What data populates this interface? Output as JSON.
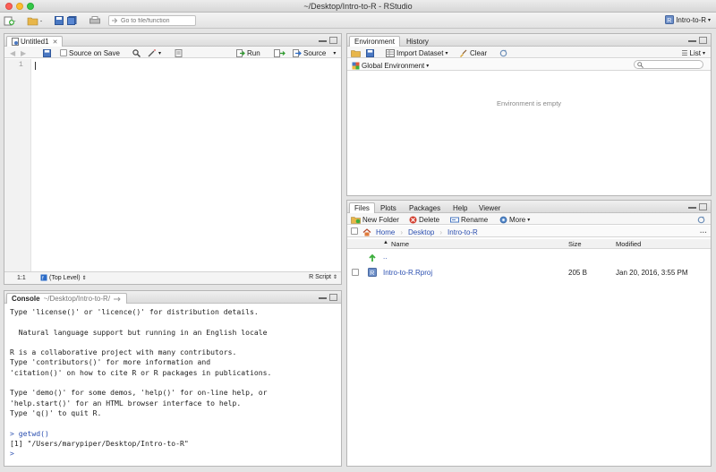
{
  "window": {
    "title": "~/Desktop/Intro-to-R - RStudio"
  },
  "toolbar": {
    "go_to_file_placeholder": "Go to file/function",
    "project_label": "Intro-to-R"
  },
  "source_pane": {
    "tab_label": "Untitled1",
    "source_on_save": "Source on Save",
    "run_label": "Run",
    "source_label": "Source",
    "line_number": "1",
    "cursor_position": "1:1",
    "scope": "(Top Level)",
    "file_type": "R Script"
  },
  "console_pane": {
    "tab_label": "Console",
    "path": "~/Desktop/Intro-to-R/",
    "lines": [
      "Type 'license()' or 'licence()' for distribution details.",
      "",
      "  Natural language support but running in an English locale",
      "",
      "R is a collaborative project with many contributors.",
      "Type 'contributors()' for more information and",
      "'citation()' on how to cite R or R packages in publications.",
      "",
      "Type 'demo()' for some demos, 'help()' for on-line help, or",
      "'help.start()' for an HTML browser interface to help.",
      "Type 'q()' to quit R.",
      ""
    ],
    "prompt": ">",
    "command": "getwd()",
    "output": "[1] \"/Users/marypiper/Desktop/Intro-to-R\""
  },
  "environment_pane": {
    "tabs": [
      "Environment",
      "History"
    ],
    "import_dataset": "Import Dataset",
    "clear_label": "Clear",
    "list_label": "List",
    "scope_label": "Global Environment",
    "empty_message": "Environment is empty"
  },
  "files_pane": {
    "tabs": [
      "Files",
      "Plots",
      "Packages",
      "Help",
      "Viewer"
    ],
    "new_folder": "New Folder",
    "delete_label": "Delete",
    "rename_label": "Rename",
    "more_label": "More",
    "breadcrumb": [
      "Home",
      "Desktop",
      "Intro-to-R"
    ],
    "columns": {
      "name": "Name",
      "size": "Size",
      "modified": "Modified"
    },
    "parent_dir": "..",
    "files": [
      {
        "name": "Intro-to-R.Rproj",
        "size": "205 B",
        "modified": "Jan 20, 2016, 3:55 PM",
        "icon": "rproj-icon"
      }
    ]
  },
  "colors": {
    "link": "#2b4fb0",
    "tab_active_bg": "#ffffff",
    "chrome_bg": "#e4e4e4"
  }
}
